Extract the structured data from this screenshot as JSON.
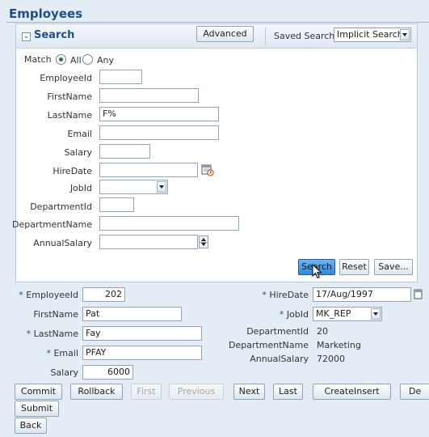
{
  "page": {
    "title": "Employees"
  },
  "search": {
    "title": "Search",
    "advanced_label": "Advanced",
    "saved_search_label": "Saved Search",
    "saved_search_value": "Implicit Search",
    "match_label": "Match",
    "match_all": "All",
    "match_any": "Any",
    "fields": {
      "employee_id": {
        "label": "EmployeeId",
        "value": ""
      },
      "first_name": {
        "label": "FirstName",
        "value": ""
      },
      "last_name": {
        "label": "LastName",
        "value": "F%"
      },
      "email": {
        "label": "Email",
        "value": ""
      },
      "salary": {
        "label": "Salary",
        "value": ""
      },
      "hire_date": {
        "label": "HireDate",
        "value": ""
      },
      "job_id": {
        "label": "JobId",
        "value": ""
      },
      "department_id": {
        "label": "DepartmentId",
        "value": ""
      },
      "department_name": {
        "label": "DepartmentName",
        "value": ""
      },
      "annual_salary": {
        "label": "AnnualSalary",
        "value": ""
      }
    },
    "search_button": "Search",
    "reset_button": "Reset",
    "save_button": "Save..."
  },
  "record": {
    "required_marker": "*",
    "employee_id": {
      "label": "EmployeeId",
      "value": "202"
    },
    "first_name": {
      "label": "FirstName",
      "value": "Pat"
    },
    "last_name": {
      "label": "LastName",
      "value": "Fay"
    },
    "email": {
      "label": "Email",
      "value": "PFAY"
    },
    "salary": {
      "label": "Salary",
      "value": "6000"
    },
    "hire_date": {
      "label": "HireDate",
      "value": "17/Aug/1997"
    },
    "job_id": {
      "label": "JobId",
      "value": "MK_REP"
    },
    "department_id": {
      "label": "DepartmentId",
      "value": "20"
    },
    "department_name": {
      "label": "DepartmentName",
      "value": "Marketing"
    },
    "annual_salary": {
      "label": "AnnualSalary",
      "value": "72000"
    }
  },
  "actions": {
    "commit": "Commit",
    "rollback": "Rollback",
    "first": "First",
    "previous": "Previous",
    "next": "Next",
    "last": "Last",
    "create_insert": "CreateInsert",
    "delete_partial": "De",
    "submit": "Submit",
    "back": "Back"
  },
  "icons": {
    "calendar": "calendar-icon",
    "cursor": "mouse-pointer-icon"
  }
}
